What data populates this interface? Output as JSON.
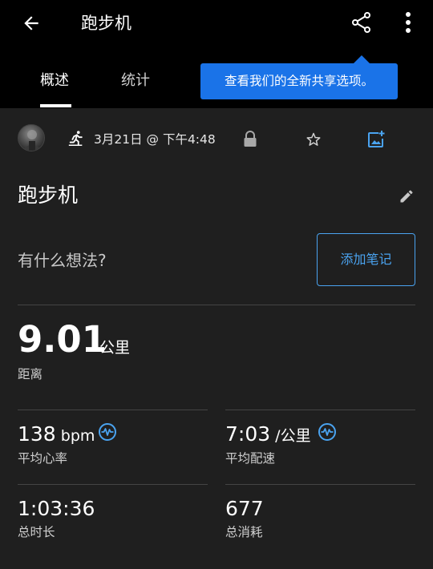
{
  "header": {
    "title": "跑步机",
    "icons": {
      "back": "arrow-left-icon",
      "share": "share-icon",
      "more": "more-vert-icon"
    }
  },
  "tabs": [
    {
      "label": "概述",
      "selected": true
    },
    {
      "label": "统计",
      "selected": false
    }
  ],
  "tooltip": {
    "text": "查看我们的全新共享选项。",
    "color": "#1a73e8"
  },
  "activity_meta": {
    "date": "3月21日 @ 下午4:48",
    "icons": {
      "avatar": "avatar",
      "type": "running-icon",
      "privacy": "lock-icon",
      "favorite": "star-outline-icon",
      "add_photo": "add-photo-icon"
    }
  },
  "activity": {
    "name": "跑步机",
    "thoughts_placeholder": "有什么想法?",
    "add_note_label": "添加笔记",
    "edit_icon": "pencil-icon"
  },
  "distance": {
    "value": "9.01",
    "unit": "公里",
    "label": "距离"
  },
  "stats": [
    {
      "value": "138",
      "unit": " bpm",
      "label": "平均心率",
      "icon": "heart-rate-icon"
    },
    {
      "value": "7:03",
      "unit": " /公里",
      "label": "平均配速",
      "icon": "heart-rate-icon"
    },
    {
      "value": "1:03:36",
      "unit": "",
      "label": "总时长"
    },
    {
      "value": "677",
      "unit": "",
      "label": "总消耗"
    }
  ],
  "colors": {
    "accent": "#4aa3f0",
    "header_bg": "#000000",
    "content_bg": "#1f1f1f"
  }
}
